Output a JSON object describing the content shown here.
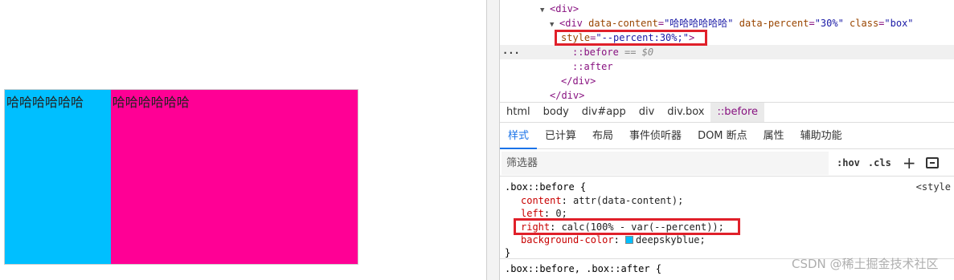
{
  "demo": {
    "before_text": "哈哈哈哈哈哈",
    "after_text": "哈哈哈哈哈哈",
    "before_color": "#00bfff",
    "box_color": "#ff0095",
    "percent": "30%"
  },
  "dom": {
    "line1_tag": "<div>",
    "line2_open": "<div ",
    "line2_attr1_name": "data-content",
    "line2_attr1_value": "\"哈哈哈哈哈哈\"",
    "line2_attr2_name": "data-percent",
    "line2_attr2_value": "\"30%\"",
    "line2_attr3_name": "class",
    "line2_attr3_value": "\"box\"",
    "line3_attr_name": "style",
    "line3_attr_value": "\"--percent:30%;\"",
    "line3_close": ">",
    "dots": "...",
    "before": "::before",
    "before_eq": "== $0",
    "after": "::after",
    "close1": "</div>",
    "close2": "</div>"
  },
  "breadcrumbs": [
    "html",
    "body",
    "div#app",
    "div",
    "div.box",
    "::before"
  ],
  "tabs": [
    "样式",
    "已计算",
    "布局",
    "事件侦听器",
    "DOM 断点",
    "属性",
    "辅助功能"
  ],
  "filter": {
    "placeholder": "筛选器",
    "hov": ":hov",
    "cls": ".cls",
    "plus": "+"
  },
  "styles": {
    "rule1_selector": ".box::before {",
    "rule1_source": "<style",
    "p1_name": "content",
    "p1_value": "attr(data-content);",
    "p2_name": "left",
    "p2_value": "0;",
    "p3_name": "right",
    "p3_value": "calc(100% - var(--percent));",
    "p4_name": "background-color",
    "p4_value": "deepskyblue;",
    "rule1_close": "}",
    "rule2_selector": ".box::before, .box::after {"
  },
  "watermark": "CSDN @稀土掘金技术社区"
}
